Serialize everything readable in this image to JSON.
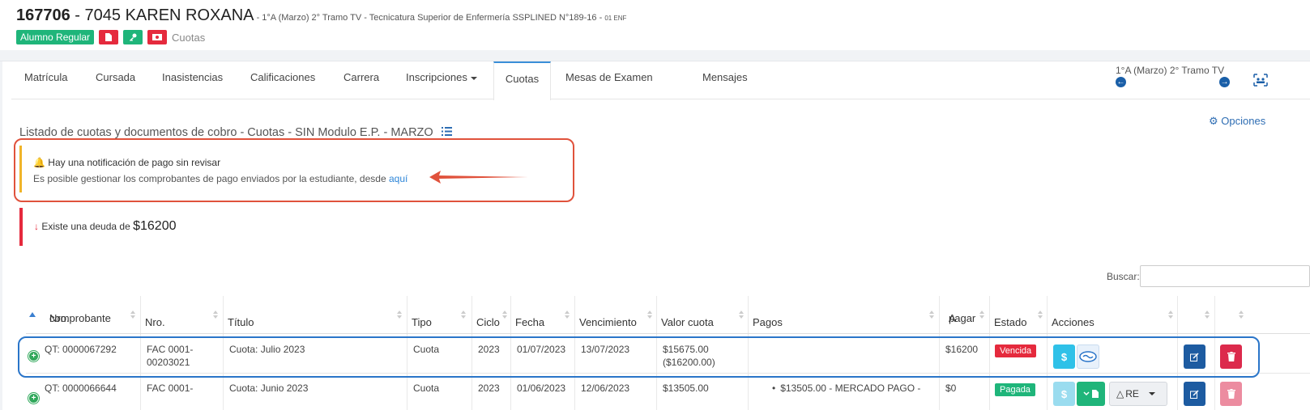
{
  "header": {
    "student_id": "167706",
    "separator": " - ",
    "student_name": "7045 KAREN ROXANA",
    "subtitle": " - 1°A (Marzo) 2° Tramo TV - Tecnicatura Superior de Enfermería SSPLINED N°189-16 - ",
    "subtitle_small": "01 ENF",
    "status_badge": "Alumno Regular",
    "cuotas_label": "Cuotas"
  },
  "tabs": [
    {
      "label": "Matrícula"
    },
    {
      "label": "Cursada"
    },
    {
      "label": "Inasistencias"
    },
    {
      "label": "Calificaciones"
    },
    {
      "label": "Carrera"
    },
    {
      "label": "Inscripciones"
    },
    {
      "label": "Cuotas"
    },
    {
      "label": "Mesas de Examen"
    },
    {
      "label": "Mensajes"
    }
  ],
  "period": "1°A (Marzo) 2° Tramo TV",
  "list_title": "Listado de cuotas y documentos de cobro - Cuotas - SIN Modulo E.P. - MARZO",
  "opciones": "Opciones",
  "notification": {
    "title": "Hay una notificación de pago sin revisar",
    "text": "Es posible gestionar los comprobantes de pago enviados por la estudiante, desde ",
    "link": "aquí"
  },
  "debt": {
    "text": "Existe una deuda de ",
    "amount": "$16200"
  },
  "search": {
    "label": "Buscar:"
  },
  "table": {
    "headers": {
      "nro_comprobante_1": "Nro.",
      "nro_comprobante_2": "comprobante",
      "nro": "Nro.",
      "titulo": "Título",
      "tipo": "Tipo",
      "ciclo": "Ciclo",
      "fecha": "Fecha",
      "vencimiento": "Vencimiento",
      "valor": "Valor cuota",
      "pagos": "Pagos",
      "apagar_1": "A",
      "apagar_2": "pagar",
      "estado": "Estado",
      "acciones": "Acciones"
    },
    "rows": [
      {
        "comprobante": "QT: 0000067292",
        "nro_1": "FAC 0001-",
        "nro_2": "00203021",
        "titulo": "Cuota: Julio 2023",
        "tipo": "Cuota",
        "ciclo": "2023",
        "fecha": "01/07/2023",
        "vencimiento": "13/07/2023",
        "valor_1": "$15675.00",
        "valor_2": "($16200.00)",
        "pagos": "",
        "apagar": "$16200",
        "estado": "Vencida"
      },
      {
        "comprobante": "QT: 0000066644",
        "nro_1": "FAC 0001-",
        "titulo": "Cuota: Junio 2023",
        "tipo": "Cuota",
        "ciclo": "2023",
        "fecha": "01/06/2023",
        "vencimiento": "12/06/2023",
        "valor_1": "$13505.00",
        "pagos": "$13505.00 - MERCADO PAGO -",
        "apagar": "$0",
        "estado": "Pagada",
        "re_label": "RE"
      }
    ]
  },
  "colors": {
    "accent_blue": "#2e86d8",
    "green": "#1fb57a",
    "red": "#e52a3d",
    "callout_red": "#e0523c",
    "row_highlight": "#2a75c9"
  }
}
